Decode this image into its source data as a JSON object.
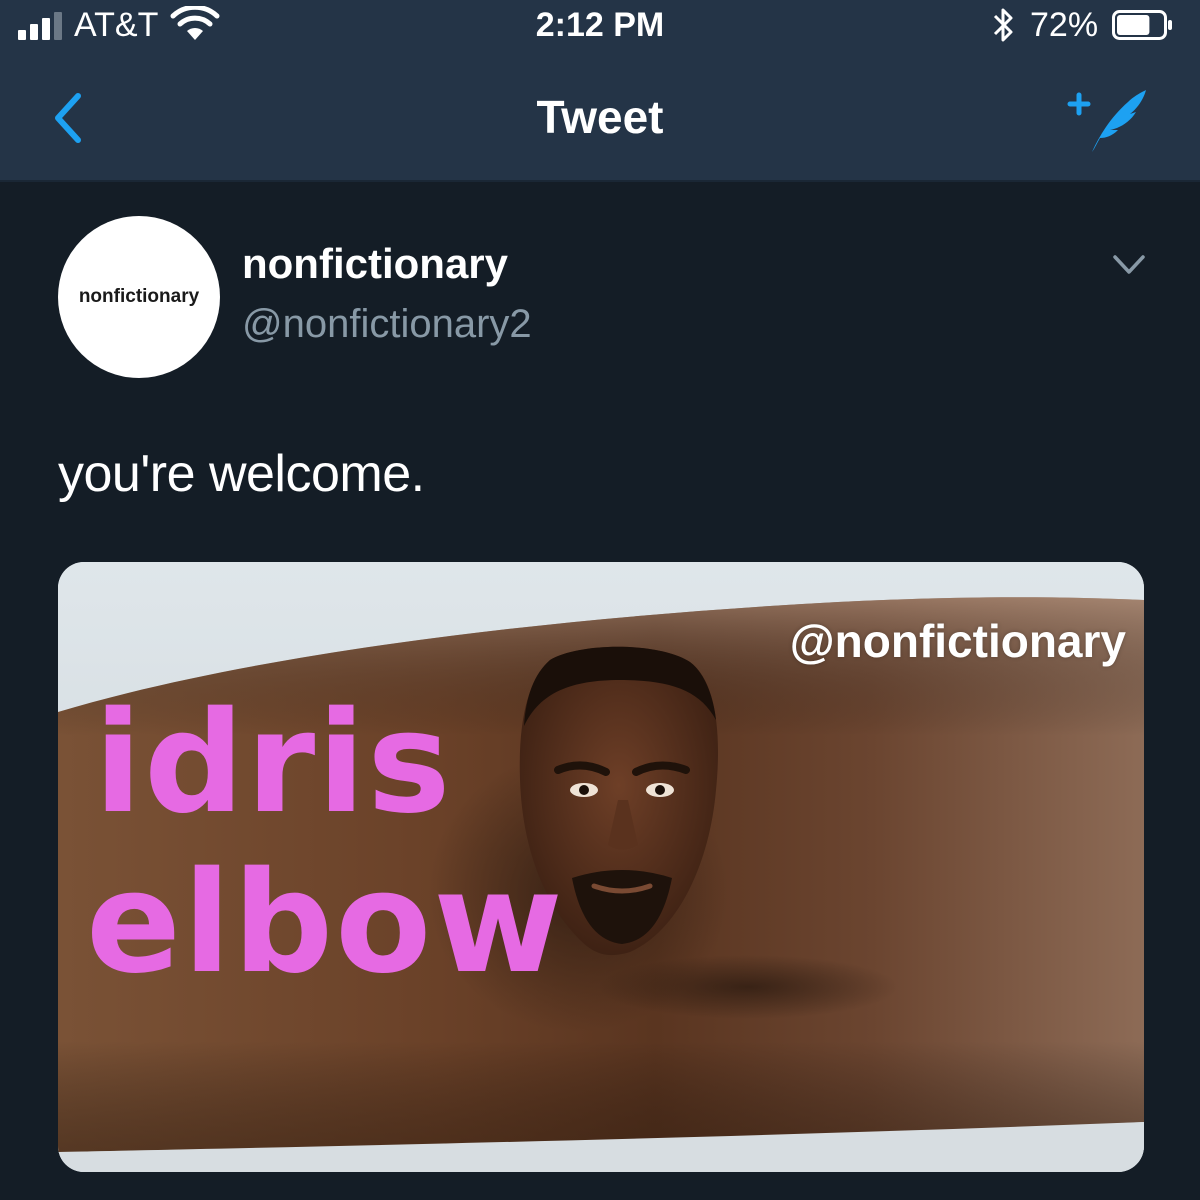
{
  "status_bar": {
    "carrier": "AT&T",
    "time": "2:12 PM",
    "battery_percent": "72%",
    "battery_level": 0.72,
    "icons": [
      "signal-icon",
      "wifi-icon",
      "bluetooth-icon",
      "battery-icon"
    ]
  },
  "nav": {
    "title": "Tweet",
    "back_icon": "chevron-left-icon",
    "compose_icon": "compose-tweet-icon"
  },
  "tweet": {
    "avatar_text": "nonfictionary",
    "display_name": "nonfictionary",
    "handle": "@nonfictionary2",
    "menu_icon": "chevron-down-icon",
    "text": "you're welcome.",
    "media": {
      "watermark": "@nonfictionary",
      "caption_line1": "idris",
      "caption_line2": "elbow"
    }
  },
  "colors": {
    "header_bg": "#243447",
    "page_bg": "#141d26",
    "accent_blue": "#1da1f2",
    "handle_gray": "#8899a6",
    "caption_pink": "#e66ae3"
  }
}
